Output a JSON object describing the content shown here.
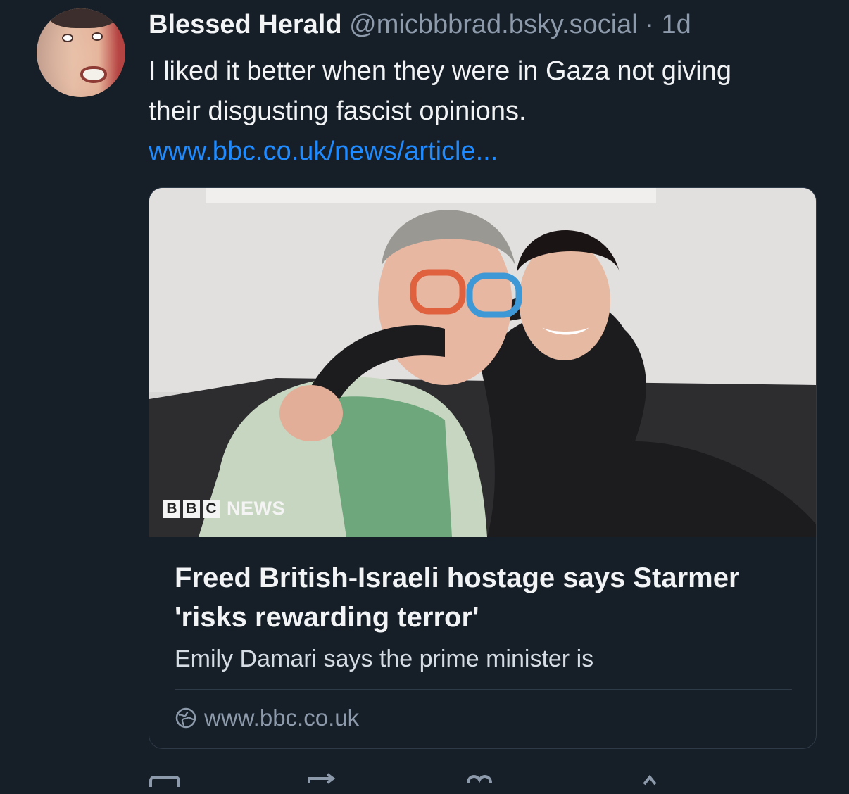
{
  "post": {
    "author": {
      "display_name": "Blessed Herald",
      "handle": "@micbbbrad.bsky.social",
      "separator": "·",
      "age": "1d"
    },
    "text": "I liked it better when they were in Gaza not giving their disgusting fascist opinions.",
    "link_text": "www.bbc.co.uk/news/article..."
  },
  "embed": {
    "image_logo_text": "NEWS",
    "logo_letters": [
      "B",
      "B",
      "C"
    ],
    "title": "Freed British-Israeli hostage says Starmer 'risks rewarding terror'",
    "description": "Emily Damari says the prime minister is",
    "source_domain": "www.bbc.co.uk",
    "source_icon": "globe-icon"
  },
  "actions": [
    "reply-icon",
    "repost-icon",
    "like-icon",
    "more-icon"
  ],
  "colors": {
    "background": "#161e27",
    "text": "#f1f3f5",
    "muted": "#8c9aab",
    "link": "#208bfe",
    "border": "#2e3a48"
  }
}
